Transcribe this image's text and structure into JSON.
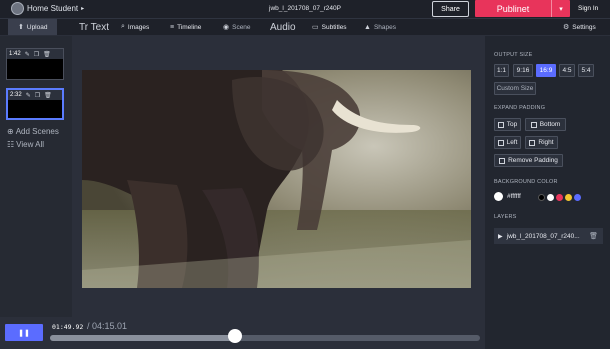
{
  "topbar": {
    "brand": "Home Student",
    "file_title": "jwb_l_201708_07_r240P",
    "share_label": "Share",
    "publish_label": "Publinet",
    "signin_label": "Sign In"
  },
  "toolbar": {
    "upload": "Upload",
    "text": "Tr Text",
    "images": "Images",
    "timeline": "Timeline",
    "scene": "Scene",
    "audio": "Audio",
    "subtitles": "Subtitles",
    "shapes": "Shapes",
    "settings": "Settings"
  },
  "scenes": [
    {
      "duration": "1:42"
    },
    {
      "duration": "2:32"
    }
  ],
  "left_panel": {
    "add_scenes": "Add Scenes",
    "view_all": "View All"
  },
  "playback": {
    "current_time": "01:49.92",
    "total_time": "/ 04:15.01",
    "progress": 0.43
  },
  "right_panel": {
    "output_size_title": "OUTPUT SIZE",
    "sizes": [
      "1:1",
      "9:16",
      "16:9",
      "4:5",
      "5:4"
    ],
    "selected_size": "16:9",
    "custom_size": "Custom Size",
    "expand_padding_title": "EXPAND PADDING",
    "padding": {
      "top": "Top",
      "bottom": "Bottom",
      "left": "Left",
      "right": "Right",
      "remove": "Remove Padding"
    },
    "background_color_title": "BACKGROUND COLOR",
    "background_value": "#ffffff",
    "swatches": [
      "#000000",
      "#ffffff",
      "#e8345b",
      "#f2c530",
      "#5b6cff"
    ],
    "layers_title": "LAYERS",
    "layer_name": "jwb_l_201708_07_r240..."
  },
  "colors": {
    "accent": "#5b6cff",
    "publish": "#e8345b"
  }
}
